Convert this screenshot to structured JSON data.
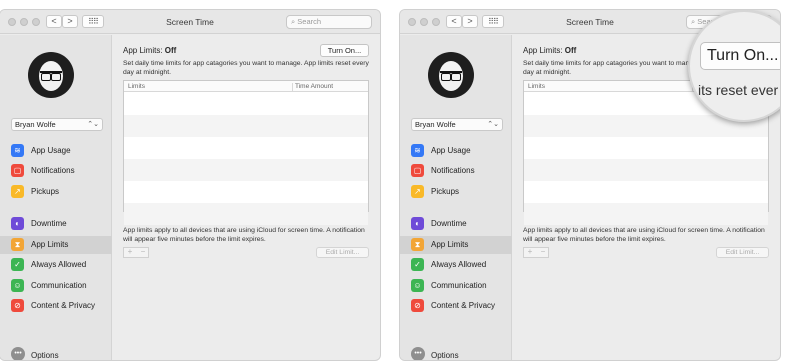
{
  "colors": {
    "app_usage": "#3478f6",
    "notifications": "#ef4a3c",
    "pickups": "#f9b928",
    "downtime": "#6f4bd8",
    "app_limits": "#f2a536",
    "always_allowed": "#3cb553",
    "communication": "#3cb553",
    "content_privacy": "#ef4a3c"
  },
  "window": {
    "title": "Screen Time",
    "search_placeholder": "Search",
    "back_glyph": "<",
    "forward_glyph": ">",
    "grid_glyph": "⠿⠿"
  },
  "sidebar": {
    "user_name": "Bryan Wolfe",
    "user_chevron": "⌃⌄",
    "items": [
      {
        "label": "App Usage",
        "icon": "layers-icon",
        "glyph": "≋"
      },
      {
        "label": "Notifications",
        "icon": "notification-icon",
        "glyph": "▢"
      },
      {
        "label": "Pickups",
        "icon": "pickups-icon",
        "glyph": "↗"
      },
      {
        "label": "Downtime",
        "icon": "moon-icon",
        "glyph": "◐"
      },
      {
        "label": "App Limits",
        "icon": "hourglass-icon",
        "glyph": "⧗"
      },
      {
        "label": "Always Allowed",
        "icon": "checkmark-icon",
        "glyph": "✓"
      },
      {
        "label": "Communication",
        "icon": "person-icon",
        "glyph": "☺"
      },
      {
        "label": "Content & Privacy",
        "icon": "restricted-icon",
        "glyph": "⊘"
      }
    ],
    "options_label": "Options",
    "options_glyph": "•••"
  },
  "main": {
    "heading_prefix": "App Limits: ",
    "heading_status": "Off",
    "turn_on_label": "Turn On...",
    "description": "Set daily time limits for app catagories you want to manage. App limits reset every day at midnight.",
    "columns": [
      "Limits",
      "Time Amount"
    ],
    "note": "App limits apply to all devices that are using iCloud for screen time. A notification will appear five minutes before the limit expires.",
    "plus_label": "+",
    "minus_label": "−",
    "edit_limit_label": "Edit Limit..."
  },
  "magnifier": {
    "button_label": "Turn On...",
    "text": "its reset ever"
  }
}
